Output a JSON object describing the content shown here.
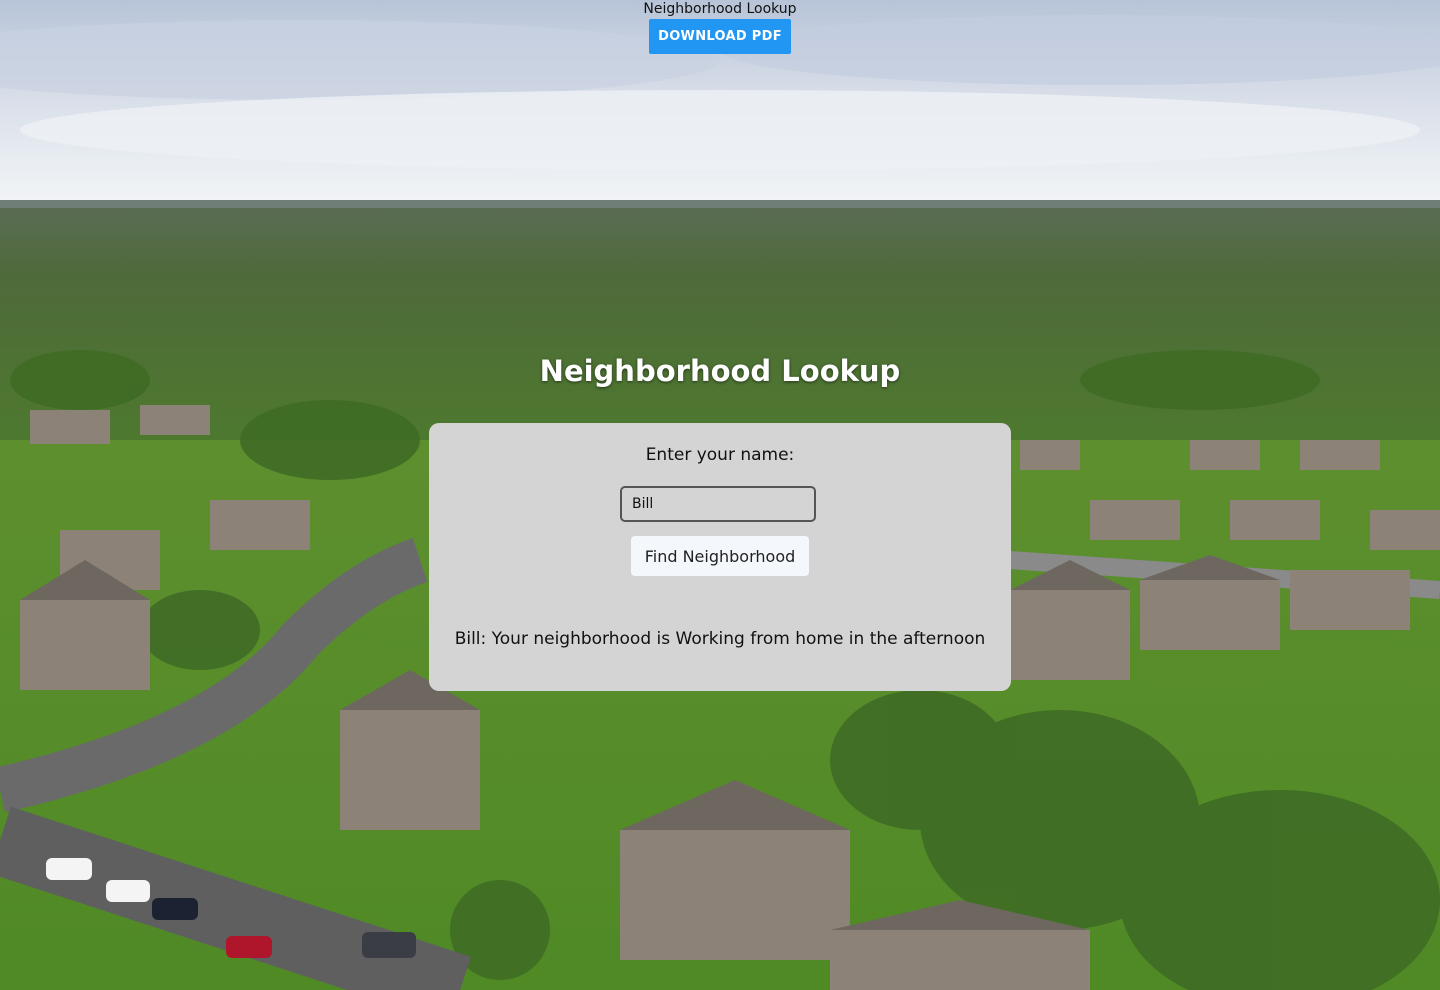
{
  "page": {
    "top_title": "Neighborhood Lookup",
    "download_label": "DOWNLOAD PDF",
    "hero_title": "Neighborhood Lookup"
  },
  "form": {
    "prompt_label": "Enter your name:",
    "name_value": "Bill",
    "find_label": "Find Neighborhood",
    "result": "Bill: Your neighborhood is Working from home in the afternoon"
  },
  "colors": {
    "download_button": "#2196f3",
    "card_background": "#d4d4d4",
    "find_button": "#f4f8fc"
  },
  "background": {
    "description_icon": "aerial-neighborhood-photo"
  }
}
